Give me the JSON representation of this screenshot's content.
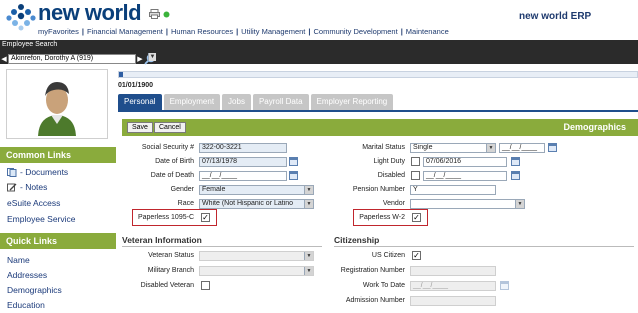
{
  "header": {
    "brand": "new world",
    "erp_title": "new world ERP",
    "nav": [
      "myFavorites",
      "Financial Management",
      "Human Resources",
      "Utility Management",
      "Community Development",
      "Maintenance"
    ],
    "nav_sep": "|"
  },
  "employee_search": {
    "label": "Employee Search",
    "selected": "Akinrefon, Dorothy A (919)"
  },
  "sidebar": {
    "common_links_title": "Common Links",
    "common_links": [
      "- Documents",
      "- Notes",
      "eSuite Access",
      "Employee Service"
    ],
    "quick_links_title": "Quick Links",
    "quick_links": [
      "Name",
      "Addresses",
      "Demographics",
      "Education"
    ]
  },
  "main": {
    "effective_date": "01/01/1900",
    "tabs": [
      "Personal",
      "Employment",
      "Jobs",
      "Payroll Data",
      "Employer Reporting"
    ],
    "active_tab": "Personal",
    "save_label": "Save",
    "cancel_label": "Cancel",
    "section_title": "Demographics"
  },
  "demographics": {
    "ssn_label": "Social Security #",
    "ssn": "322-00-3221",
    "dob_label": "Date of Birth",
    "dob": "07/13/1978",
    "dod_label": "Date of Death",
    "dod": "__/__/____",
    "gender_label": "Gender",
    "gender": "Female",
    "race_label": "Race",
    "race": "White (Not Hispanic or Latino",
    "paperless1095_label": "Paperless 1095-C",
    "paperless1095": true,
    "marital_label": "Marital Status",
    "marital": "Single",
    "marital_date": "__/__/____",
    "lightduty_label": "Light Duty",
    "lightduty": false,
    "lightduty_date": "07/06/2016",
    "disabled_label": "Disabled",
    "disabled": false,
    "disabled_date": "__/__/____",
    "pension_label": "Pension Number",
    "pension": "Y",
    "vendor_label": "Vendor",
    "vendor": "",
    "paperlessw2_label": "Paperless W-2",
    "paperlessw2": true
  },
  "veteran": {
    "title": "Veteran Information",
    "status_label": "Veteran Status",
    "status": "",
    "branch_label": "Military Branch",
    "branch": "",
    "disabled_label": "Disabled Veteran",
    "disabled": false
  },
  "citizenship": {
    "title": "Citizenship",
    "us_citizen_label": "US Citizen",
    "us_citizen": true,
    "registration_label": "Registration Number",
    "registration": "",
    "work_to_date_label": "Work To Date",
    "work_to_date": "__/__/____",
    "admission_label": "Admission Number",
    "admission": ""
  },
  "icons": [
    "logo-dots-icon",
    "printer-icon",
    "status-dot-icon",
    "search-icon",
    "user-avatar-icon",
    "documents-icon",
    "notes-icon",
    "calendar-icon",
    "dropdown-arrow-icon",
    "checkmark-icon"
  ],
  "colors": {
    "brand": "#0a3f7a",
    "green_bar": "#8aab3c",
    "tab_active": "#1f4e8c",
    "highlight_red": "#c0262d"
  }
}
